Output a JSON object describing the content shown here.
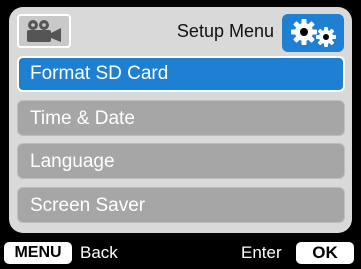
{
  "header": {
    "title": "Setup Menu",
    "left_icon": "video-camera-icon",
    "right_icon": "gears-icon"
  },
  "menu": {
    "items": [
      {
        "label": "Format SD Card",
        "selected": true
      },
      {
        "label": "Time & Date",
        "selected": false
      },
      {
        "label": "Language",
        "selected": false
      },
      {
        "label": "Screen Saver",
        "selected": false
      }
    ]
  },
  "footer": {
    "menu_key": "MENU",
    "back_label": "Back",
    "enter_label": "Enter",
    "ok_key": "OK"
  },
  "colors": {
    "accent": "#1f7fd1",
    "panel": "#d9d9d9",
    "item": "#a6a6a6",
    "background": "#000000"
  }
}
